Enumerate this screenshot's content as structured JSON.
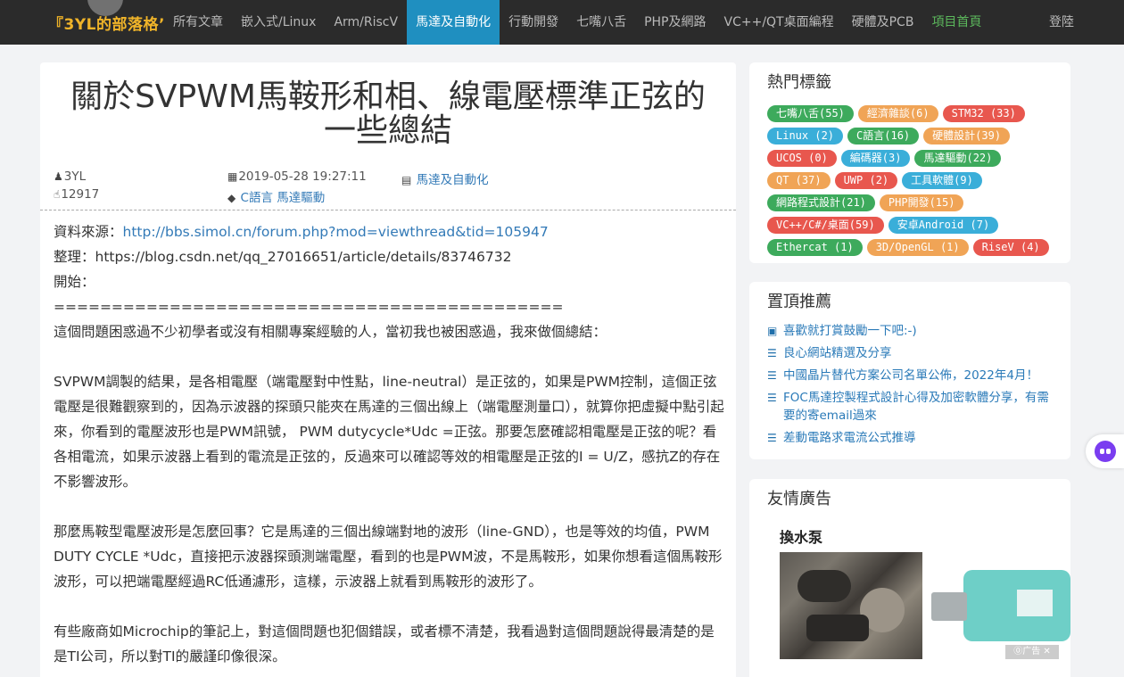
{
  "nav": {
    "logo": "『3YL的部落格’",
    "items": [
      {
        "label": "所有文章"
      },
      {
        "label": "嵌入式/Linux"
      },
      {
        "label": "Arm/RiscV"
      },
      {
        "label": "馬達及自動化"
      },
      {
        "label": "行動開發"
      },
      {
        "label": "七嘴八舌"
      },
      {
        "label": "PHP及網路"
      },
      {
        "label": "VC++/QT桌面編程"
      },
      {
        "label": "硬體及PCB"
      },
      {
        "label": "項目首頁"
      }
    ],
    "active_index": 3,
    "login": "登陸"
  },
  "article": {
    "title": "關於SVPWM馬鞍形和相、線電壓標準正弦的一些總結",
    "author": "3YL",
    "views": "12917",
    "datetime": "2019-05-28 19:27:11",
    "category": "馬達及自動化",
    "tags": [
      "C語言",
      "馬達驅動"
    ],
    "source_label": "資料來源：",
    "source_url": "http://bbs.simol.cn/forum.php?mod=viewthread&tid=105947",
    "compile_label": "整理：",
    "compile_url": "https://blog.csdn.net/qq_27016651/article/details/83746732",
    "start_label": "開始：",
    "divider": "============================================",
    "paragraphs": [
      "這個問題困惑過不少初學者或沒有相關專案經驗的人，當初我也被困惑過，我來做個總結：",
      "SVPWM調製的結果，是各相電壓（端電壓對中性點，line-neutral）是正弦的，如果是PWM控制，這個正弦電壓是很難觀察到的，因為示波器的探頭只能夾在馬達的三個出線上（端電壓測量口），就算你把虛擬中點引起來，你看到的電壓波形也是PWM訊號， PWM dutycycle*Udc =正弦。那要怎麼確認相電壓是正弦的呢？看各相電流，如果示波器上看到的電流是正弦的，反過來可以確認等效的相電壓是正弦的I = U/Z，感抗Z的存在不影響波形。",
      "那麼馬鞍型電壓波形是怎麼回事？它是馬達的三個出線端對地的波形（line-GND），也是等效的均值，PWM DUTY CYCLE *Udc，直接把示波器探頭測端電壓，看到的也是PWM波，不是馬鞍形，如果你想看這個馬鞍形波形，可以把端電壓經過RC低通濾形，這樣，示波器上就看到馬鞍形的波形了。",
      "有些廠商如Microchip的筆記上，對這個問題也犯個錯誤，或者標不清楚，我看過對這個問題說得最清楚的是是TI公司，所以對TI的嚴謹印像很深。"
    ]
  },
  "sidebar": {
    "tags_title": "熱門標籤",
    "tag_rows": [
      [
        {
          "label": "七嘴八舌(55)",
          "color": "#3daa5c"
        },
        {
          "label": "經濟雜談(6)",
          "color": "#f0a456"
        },
        {
          "label": "STM32 (33)",
          "color": "#e8574e"
        }
      ],
      [
        {
          "label": "Linux (2)",
          "color": "#3aaed9"
        },
        {
          "label": "C語言(16)",
          "color": "#3daa5c"
        },
        {
          "label": "硬體設計(39)",
          "color": "#f0a456"
        }
      ],
      [
        {
          "label": "UCOS (0)",
          "color": "#e8574e"
        },
        {
          "label": "編碼器(3)",
          "color": "#3aaed9"
        },
        {
          "label": "馬達驅動(22)",
          "color": "#3daa5c"
        }
      ],
      [
        {
          "label": "QT (37)",
          "color": "#f0a456"
        },
        {
          "label": "UWP (2)",
          "color": "#e8574e"
        },
        {
          "label": "工具軟體(9)",
          "color": "#3aaed9"
        }
      ],
      [
        {
          "label": "網路程式設計(21)",
          "color": "#3daa5c"
        },
        {
          "label": "PHP開發(15)",
          "color": "#f0a456"
        }
      ],
      [
        {
          "label": "VC++/C#/桌面(59)",
          "color": "#e8574e"
        },
        {
          "label": "安卓Android (7)",
          "color": "#3aaed9"
        }
      ],
      [
        {
          "label": "Ethercat (1)",
          "color": "#3daa5c"
        },
        {
          "label": "3D/OpenGL (1)",
          "color": "#f0a456"
        },
        {
          "label": "RiseV (4)",
          "color": "#e8574e"
        }
      ]
    ],
    "rec_title": "置頂推薦",
    "rec_items": [
      {
        "icon": "money-icon",
        "label": "喜歡就打賞鼓勵一下吧:-)"
      },
      {
        "icon": "list-icon",
        "label": "良心網站精選及分享"
      },
      {
        "icon": "list-icon",
        "label": "中國晶片替代方案公司名單公佈，2022年4月！"
      },
      {
        "icon": "list-icon",
        "label": "FOC馬達控製程式設計心得及加密軟體分享，有需要的寄email過來"
      },
      {
        "icon": "list-icon",
        "label": "差動電路求電流公式推導"
      }
    ],
    "ad_title": "友情廣告",
    "ad_name": "換水泵",
    "ad_badge": "⓪广告 ✕"
  }
}
